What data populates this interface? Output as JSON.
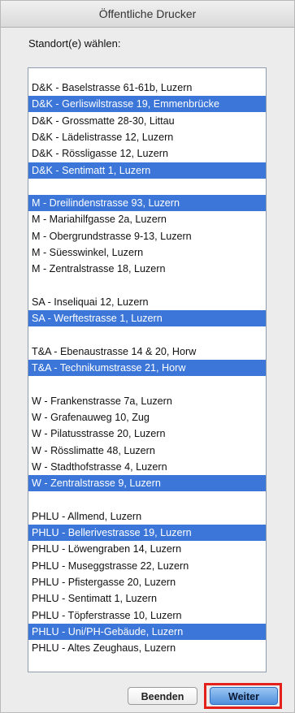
{
  "window": {
    "title": "Öffentliche Drucker"
  },
  "prompt": "Standort(e) wählen:",
  "locations": [
    {
      "label": "D&K - Baselstrasse 61-61b, Luzern",
      "selected": false,
      "slot": 0
    },
    {
      "label": "D&K - Gerliswilstrasse 19, Emmenbrücke",
      "selected": true,
      "slot": 1
    },
    {
      "label": "D&K - Grossmatte 28-30, Littau",
      "selected": false,
      "slot": 2
    },
    {
      "label": "D&K - Lädelistrasse 12, Luzern",
      "selected": false,
      "slot": 3
    },
    {
      "label": "D&K - Rössligasse 12, Luzern",
      "selected": false,
      "slot": 4
    },
    {
      "label": "D&K - Sentimatt 1, Luzern",
      "selected": true,
      "slot": 5
    },
    {
      "label": "M - Dreilindenstrasse 93, Luzern",
      "selected": true,
      "slot": 7
    },
    {
      "label": "M - Mariahilfgasse 2a, Luzern",
      "selected": false,
      "slot": 8
    },
    {
      "label": "M - Obergrundstrasse 9-13, Luzern",
      "selected": false,
      "slot": 9
    },
    {
      "label": "M - Süesswinkel, Luzern",
      "selected": false,
      "slot": 10
    },
    {
      "label": "M - Zentralstrasse 18, Luzern",
      "selected": false,
      "slot": 11
    },
    {
      "label": "SA - Inseliquai 12, Luzern",
      "selected": false,
      "slot": 13
    },
    {
      "label": "SA - Werftestrasse 1, Luzern",
      "selected": true,
      "slot": 14
    },
    {
      "label": "T&A - Ebenaustrasse 14 & 20, Horw",
      "selected": false,
      "slot": 16
    },
    {
      "label": "T&A - Technikumstrasse 21, Horw",
      "selected": true,
      "slot": 17
    },
    {
      "label": "W - Frankenstrasse 7a, Luzern",
      "selected": false,
      "slot": 19
    },
    {
      "label": "W - Grafenauweg 10, Zug",
      "selected": false,
      "slot": 20
    },
    {
      "label": "W - Pilatusstrasse 20, Luzern",
      "selected": false,
      "slot": 21
    },
    {
      "label": "W - Rösslimatte 48, Luzern",
      "selected": false,
      "slot": 22
    },
    {
      "label": "W - Stadthofstrasse 4, Luzern",
      "selected": false,
      "slot": 23
    },
    {
      "label": "W - Zentralstrasse 9, Luzern",
      "selected": true,
      "slot": 24
    },
    {
      "label": "PHLU - Allmend, Luzern",
      "selected": false,
      "slot": 26
    },
    {
      "label": "PHLU - Bellerivestrasse 19, Luzern",
      "selected": true,
      "slot": 27
    },
    {
      "label": "PHLU - Löwengraben 14, Luzern",
      "selected": false,
      "slot": 28
    },
    {
      "label": "PHLU - Museggstrasse 22, Luzern",
      "selected": false,
      "slot": 29
    },
    {
      "label": "PHLU - Pfistergasse 20, Luzern",
      "selected": false,
      "slot": 30
    },
    {
      "label": "PHLU - Sentimatt 1, Luzern",
      "selected": false,
      "slot": 31
    },
    {
      "label": "PHLU - Töpferstrasse 10, Luzern",
      "selected": false,
      "slot": 32
    },
    {
      "label": "PHLU - Uni/PH-Gebäude, Luzern",
      "selected": true,
      "slot": 33
    },
    {
      "label": "PHLU - Altes Zeughaus, Luzern",
      "selected": false,
      "slot": 34
    }
  ],
  "buttons": {
    "cancel": "Beenden",
    "continue": "Weiter"
  },
  "colors": {
    "selection": "#3b76d8",
    "highlight_outline": "#e4201a",
    "default_button": "#4f8fdc"
  }
}
